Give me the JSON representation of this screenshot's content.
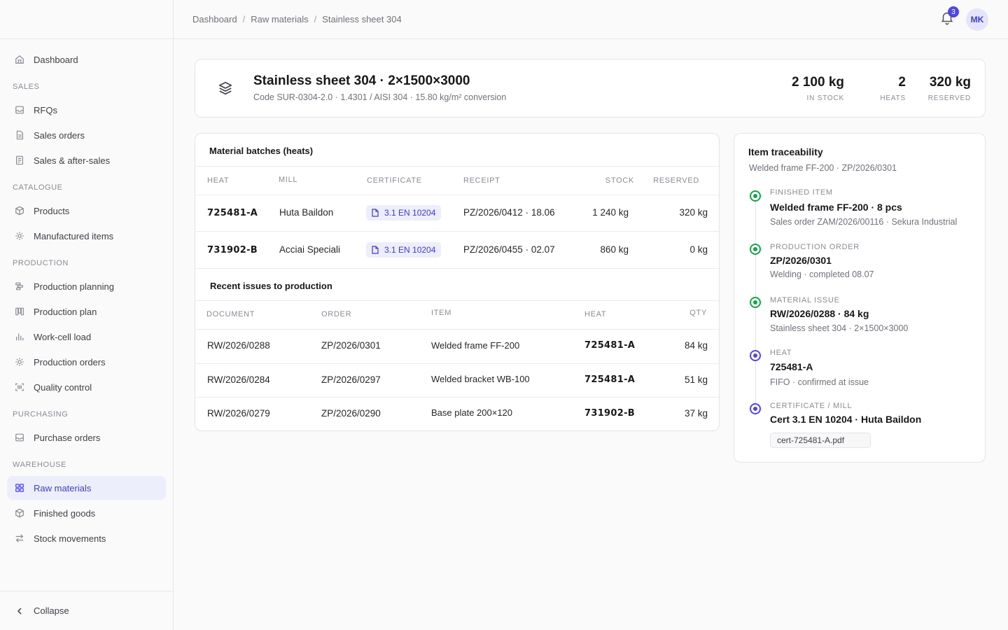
{
  "sidebar": {
    "top_items": [
      {
        "label": "Dashboard",
        "icon": "home-icon"
      }
    ],
    "sections": [
      {
        "title": "SALES",
        "items": [
          {
            "label": "RFQs",
            "icon": "inbox-icon"
          },
          {
            "label": "Sales orders",
            "icon": "file-icon"
          },
          {
            "label": "Sales & after-sales",
            "icon": "receipt-icon"
          }
        ]
      },
      {
        "title": "CATALOGUE",
        "items": [
          {
            "label": "Products",
            "icon": "box-icon"
          },
          {
            "label": "Manufactured items",
            "icon": "cog-icon"
          }
        ]
      },
      {
        "title": "PRODUCTION",
        "items": [
          {
            "label": "Production planning",
            "icon": "gantt-icon"
          },
          {
            "label": "Production plan",
            "icon": "columns-icon"
          },
          {
            "label": "Work-cell load",
            "icon": "bar-chart-icon"
          },
          {
            "label": "Production orders",
            "icon": "cog-icon"
          },
          {
            "label": "Quality control",
            "icon": "scan-icon"
          }
        ]
      },
      {
        "title": "PURCHASING",
        "items": [
          {
            "label": "Purchase orders",
            "icon": "inbox-icon"
          }
        ]
      },
      {
        "title": "WAREHOUSE",
        "items": [
          {
            "label": "Raw materials",
            "icon": "grid-icon",
            "active": true
          },
          {
            "label": "Finished goods",
            "icon": "box-icon"
          },
          {
            "label": "Stock movements",
            "icon": "arrows-icon"
          }
        ]
      }
    ],
    "collapse_label": "Collapse"
  },
  "header": {
    "breadcrumbs": [
      "Dashboard",
      "Raw materials",
      "Stainless sheet 304"
    ],
    "notification_count": "3",
    "avatar_initials": "MK"
  },
  "item": {
    "title": "Stainless sheet 304 · 2×1500×3000",
    "subtitle": "Code SUR-0304-2.0 · 1.4301 / AISI 304 · 15.80 kg/m² conversion",
    "stats": [
      {
        "value": "2 100 kg",
        "label": "IN STOCK"
      },
      {
        "value": "2",
        "label": "HEATS"
      },
      {
        "value": "320 kg",
        "label": "RESERVED"
      }
    ]
  },
  "batches": {
    "title": "Material batches (heats)",
    "columns": [
      "HEAT",
      "MILL",
      "CERTIFICATE",
      "RECEIPT",
      "STOCK",
      "RESERVED"
    ],
    "rows": [
      {
        "heat": "725481-A",
        "mill": "Huta Baildon",
        "certificate": "3.1 EN 10204",
        "receipt": "PZ/2026/0412 · 18.06",
        "stock": "1 240 kg",
        "reserved": "320 kg"
      },
      {
        "heat": "731902-B",
        "mill": "Acciai Speciali",
        "certificate": "3.1 EN 10204",
        "receipt": "PZ/2026/0455 · 02.07",
        "stock": "860 kg",
        "reserved": "0 kg"
      }
    ]
  },
  "issues": {
    "title": "Recent issues to production",
    "columns": [
      "DOCUMENT",
      "ORDER",
      "ITEM",
      "HEAT",
      "QTY"
    ],
    "rows": [
      {
        "document": "RW/2026/0288",
        "order": "ZP/2026/0301",
        "item": "Welded frame FF-200",
        "heat": "725481-A",
        "qty": "84 kg"
      },
      {
        "document": "RW/2026/0284",
        "order": "ZP/2026/0297",
        "item": "Welded bracket WB-100",
        "heat": "725481-A",
        "qty": "51 kg"
      },
      {
        "document": "RW/2026/0279",
        "order": "ZP/2026/0290",
        "item": "Base plate 200×120",
        "heat": "731902-B",
        "qty": "37 kg"
      }
    ]
  },
  "traceability": {
    "title": "Item traceability",
    "subtitle": "Welded frame FF-200 · ZP/2026/0301",
    "steps": [
      {
        "label": "FINISHED ITEM",
        "value": "Welded frame FF-200 · 8 pcs",
        "desc": "Sales order ZAM/2026/00116 · Sekura Industrial",
        "status": "green"
      },
      {
        "label": "PRODUCTION ORDER",
        "value": "ZP/2026/0301",
        "desc": "Welding · completed 08.07",
        "status": "green"
      },
      {
        "label": "MATERIAL ISSUE",
        "value": "RW/2026/0288 · 84 kg",
        "desc": "Stainless sheet 304 · 2×1500×3000",
        "status": "green"
      },
      {
        "label": "HEAT",
        "value": "725481-A",
        "desc": "FIFO · confirmed at issue",
        "status": "blue"
      },
      {
        "label": "CERTIFICATE / MILL",
        "value": "Cert 3.1 EN 10204 · Huta Baildon",
        "desc": "",
        "status": "blue"
      }
    ],
    "file": "cert-725481-A.pdf"
  },
  "colors": {
    "accent": "#4f46e5",
    "success": "#16a34a",
    "active_bg": "#eceefc"
  }
}
